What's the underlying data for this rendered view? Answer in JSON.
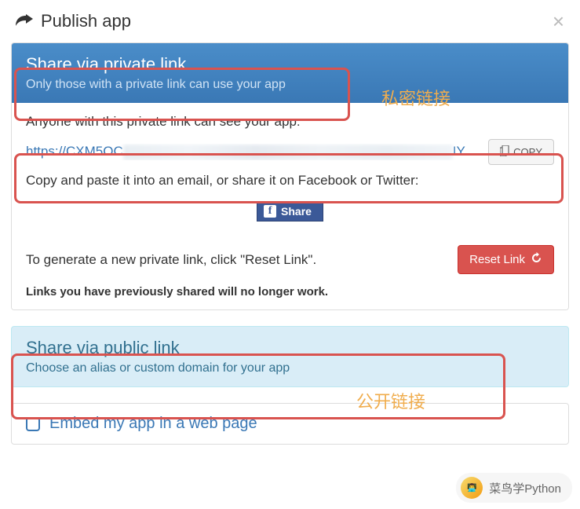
{
  "modal": {
    "title": "Publish app"
  },
  "private": {
    "heading": "Share via private link",
    "subheading": "Only those with a private link can use your app",
    "annotation": "私密链接",
    "instruction": "Anyone with this private link can see your app:",
    "link_prefix": "https://CXM5OC",
    "link_suffix": "IY…",
    "copy_label": "COPY",
    "paste_hint": "Copy and paste it into an email, or share it on Facebook or Twitter:",
    "fb_share_label": "Share",
    "reset_instruction": "To generate a new private link, click \"Reset Link\".",
    "reset_button": "Reset Link",
    "warning": "Links you have previously shared will no longer work."
  },
  "public": {
    "heading": "Share via public link",
    "subheading": "Choose an alias or custom domain for your app",
    "annotation": "公开链接"
  },
  "embed": {
    "label": "Embed my app in a web page"
  },
  "watermark": {
    "text": "菜鸟学Python"
  }
}
